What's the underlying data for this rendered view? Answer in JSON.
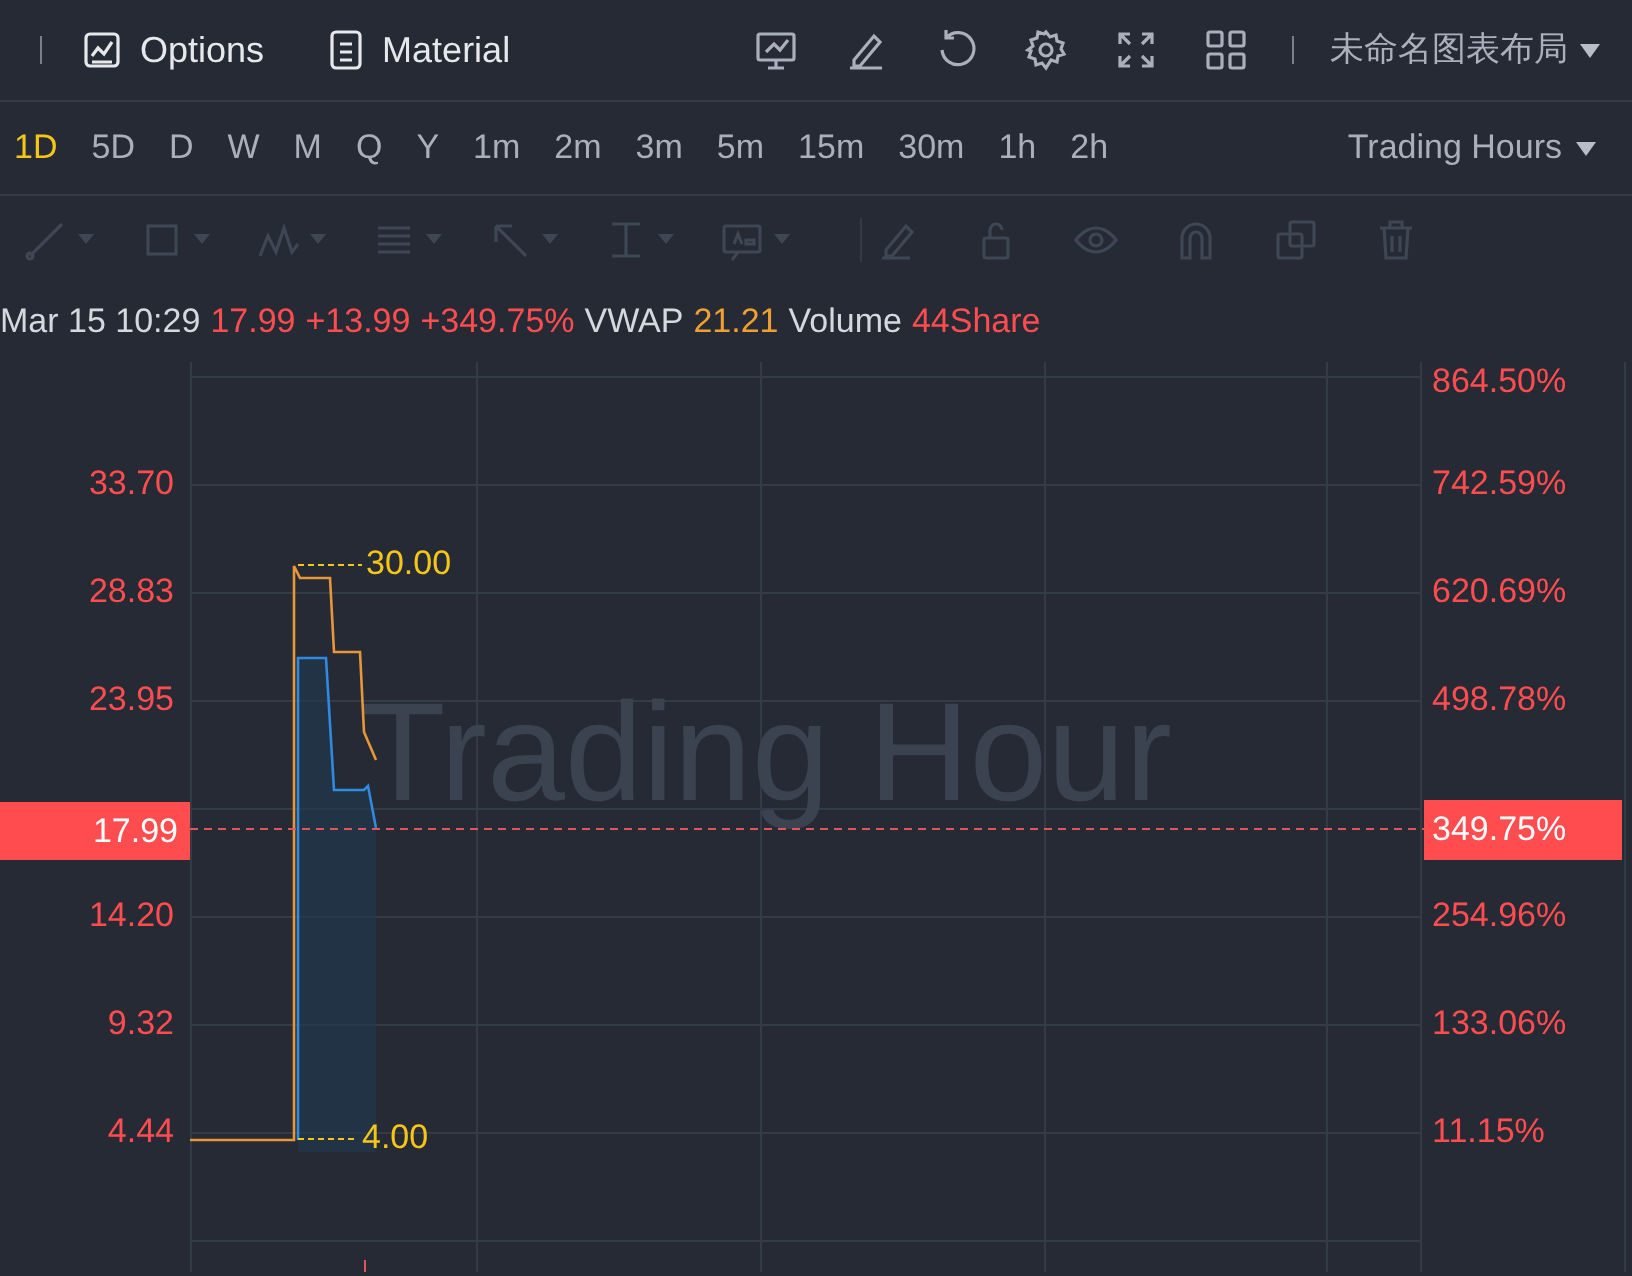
{
  "top_bar": {
    "menus": [
      {
        "label": "Options",
        "kind": "chart"
      },
      {
        "label": "Material",
        "kind": "doc"
      }
    ],
    "layout_name": "未命名图表布局"
  },
  "timeframes": [
    {
      "label": "1D",
      "selected": true
    },
    {
      "label": "5D",
      "selected": false
    },
    {
      "label": "D",
      "selected": false
    },
    {
      "label": "W",
      "selected": false
    },
    {
      "label": "M",
      "selected": false
    },
    {
      "label": "Q",
      "selected": false
    },
    {
      "label": "Y",
      "selected": false
    },
    {
      "label": "1m",
      "selected": false
    },
    {
      "label": "2m",
      "selected": false
    },
    {
      "label": "3m",
      "selected": false
    },
    {
      "label": "5m",
      "selected": false
    },
    {
      "label": "15m",
      "selected": false
    },
    {
      "label": "30m",
      "selected": false
    },
    {
      "label": "1h",
      "selected": false
    },
    {
      "label": "2h",
      "selected": false
    }
  ],
  "session_dropdown": "Trading Hours",
  "quote_line": [
    {
      "text": "Mar 15 10:29",
      "kind": "label"
    },
    {
      "text": "17.99",
      "kind": "price"
    },
    {
      "text": "+13.99",
      "kind": "price"
    },
    {
      "text": "+349.75%",
      "kind": "price"
    },
    {
      "text": "VWAP",
      "kind": "label"
    },
    {
      "text": "21.21",
      "kind": "vwap"
    },
    {
      "text": "Volume",
      "kind": "label"
    },
    {
      "text": "44Share",
      "kind": "price"
    }
  ],
  "chart": {
    "watermark": "Trading Hour",
    "price_axis": [
      "33.70",
      "28.83",
      "23.95",
      "14.20",
      "9.32",
      "4.44"
    ],
    "percent_axis": [
      "864.50%",
      "742.59%",
      "620.69%",
      "498.78%",
      "254.96%",
      "133.06%",
      "11.15%"
    ],
    "high_label": "30.00",
    "low_label": "4.00",
    "last_price": "17.99",
    "last_change": "349.75%"
  }
}
